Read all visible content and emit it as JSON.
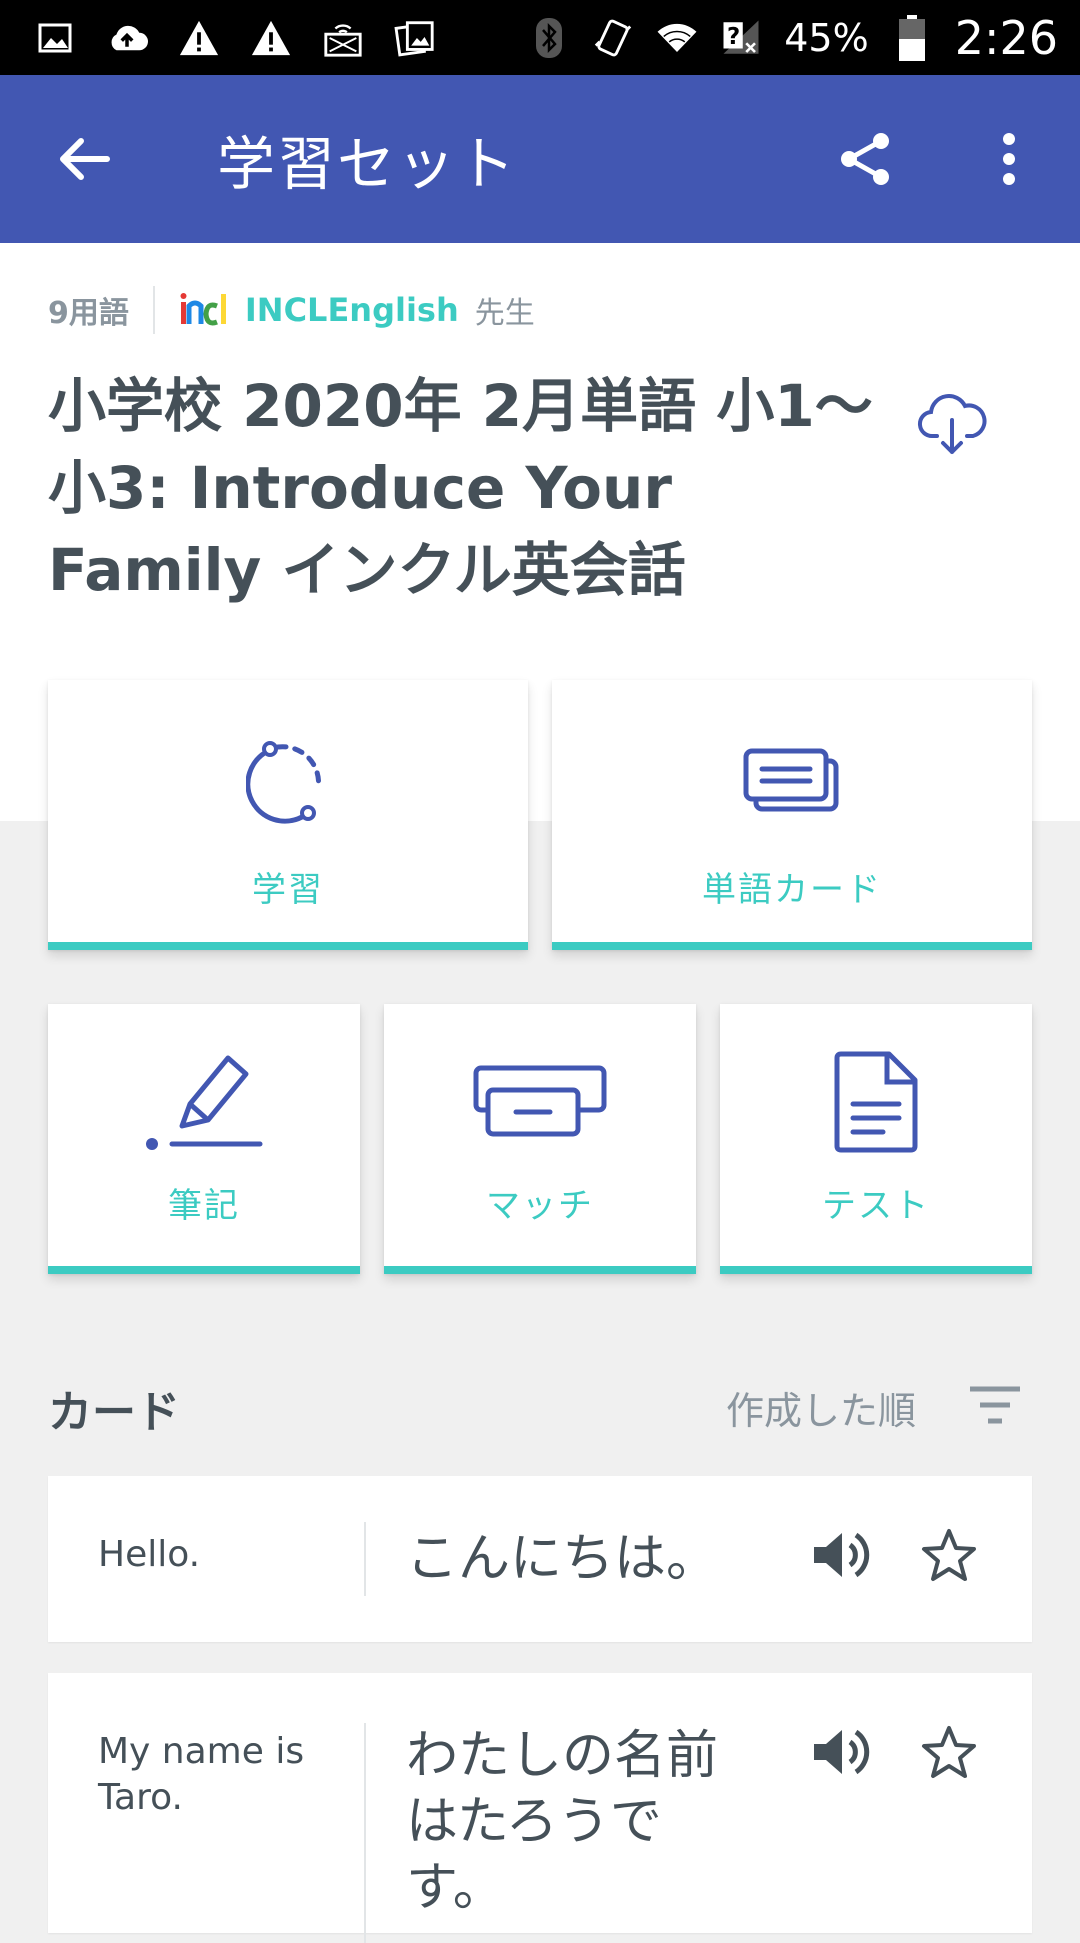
{
  "status_bar": {
    "battery_percent": "45%",
    "time": "2:26",
    "icons": [
      "image-icon",
      "cloud-upload-icon",
      "warning-icon",
      "warning-icon",
      "cast-icon",
      "photos-icon",
      "bluetooth-icon",
      "vibrate-icon",
      "wifi-icon",
      "no-signal-icon",
      "battery-icon"
    ]
  },
  "app_bar": {
    "title": "学習セット",
    "icons": [
      "back-arrow-icon",
      "share-icon",
      "more-vert-icon"
    ],
    "background": "#4257b2"
  },
  "set_info": {
    "term_count": "9用語",
    "author": "INCLEnglish",
    "role": "先生",
    "title": "小学校 2020年 2月単語 小1〜小3: Introduce Your Family インクル英会話"
  },
  "modes": {
    "learn": "学習",
    "flashcards": "単語カード",
    "write": "筆記",
    "match": "マッチ",
    "test": "テスト"
  },
  "cards_section": {
    "heading": "カード",
    "sort_label": "作成した順"
  },
  "terms": [
    {
      "term": "Hello.",
      "definition": "こんにちは。"
    },
    {
      "term": "My name is Taro.",
      "definition": "わたしの名前はたろうです。"
    }
  ],
  "colors": {
    "accent": "#3ccbc2",
    "primary": "#4257b2",
    "text": "#455058",
    "muted": "#8a959e"
  }
}
